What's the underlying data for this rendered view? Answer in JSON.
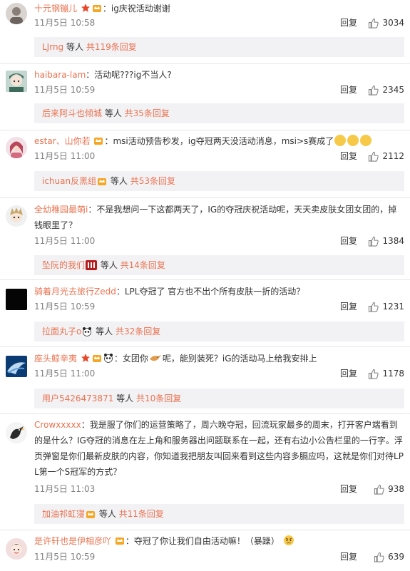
{
  "colors": {
    "name": "#eb7350",
    "text": "#333333",
    "meta": "#808080",
    "subbox_bg": "#f2f2f5"
  },
  "comments": [
    {
      "user": "十元钢镚儿",
      "content": "ig庆祝活动谢谢",
      "time": "11月5日 10:58",
      "reply": "回复",
      "likes": "3034",
      "sub_user": "LJrng",
      "sub_mid": " 等人 ",
      "sub_count": "共119条回复"
    },
    {
      "user": "haibara-lam",
      "content": "活动呢???ig不当人?",
      "time": "11月5日 10:59",
      "reply": "回复",
      "likes": "2345",
      "sub_user": "后来阿斗也倾城",
      "sub_mid": " 等人 ",
      "sub_count": "共35条回复"
    },
    {
      "user": "estar、山你若",
      "content": "msi活动预告秒发，ig夺冠两天没活动消息，msi>s赛成了",
      "time": "11月5日 11:00",
      "reply": "回复",
      "likes": "2112",
      "sub_user": "ichuan反黑组",
      "sub_mid": " 等人 ",
      "sub_count": "共53条回复"
    },
    {
      "user": "全幼稚园最萌i",
      "content": "不是我想问一下这都两天了，IG的夺冠庆祝活动呢，天天卖皮肤女团女团的，掉钱眼里了？",
      "time": "11月5日 11:00",
      "reply": "回复",
      "likes": "1384",
      "sub_user": "坠阮的我们",
      "sub_mid": " 等人 ",
      "sub_count": "共14条回复"
    },
    {
      "user": "骑着月光去旅行Zedd",
      "content": "LPL夺冠了 官方也不出个所有皮肤一折的活动？",
      "time": "11月5日 10:59",
      "reply": "回复",
      "likes": "1231",
      "sub_user": "拉面丸子o",
      "sub_mid": " 等人 ",
      "sub_count": "共32条回复"
    },
    {
      "user": "座头鲸辛夷",
      "content": "女团你",
      "content2": "呢，能别装死？iG的活动马上给我安排上",
      "time": "11月5日 11:00",
      "reply": "回复",
      "likes": "1178",
      "sub_user": "用户5426473871",
      "sub_mid": " 等人 ",
      "sub_count": "共10条回复"
    },
    {
      "user": "Crowxxxxx",
      "content": "我是服了你们的运营策略了，周六晚夺冠，回流玩家最多的周末，打开客户端看到的是什么？IG夺冠的消息在左上角和服务器出问题联系在一起，还有右边小公告栏里的一行字。浮页弹窗是你们最新皮肤的内容，你知道我把朋友叫回来看到这些内容多膈应吗，这就是你们对待LPL第一个S冠军的方式？",
      "time": "11月5日 11:03",
      "reply": "回复",
      "likes": "938",
      "sub_user": "加油祁虹寖",
      "sub_mid": " 等人 ",
      "sub_count": "共11条回复"
    },
    {
      "user": "是许轩也是伊相彦吖",
      "content": "夺冠了你让我们自由活动嘛！（暴躁）",
      "time": "11月5日 10:59",
      "reply": "回复",
      "likes": "639"
    }
  ]
}
